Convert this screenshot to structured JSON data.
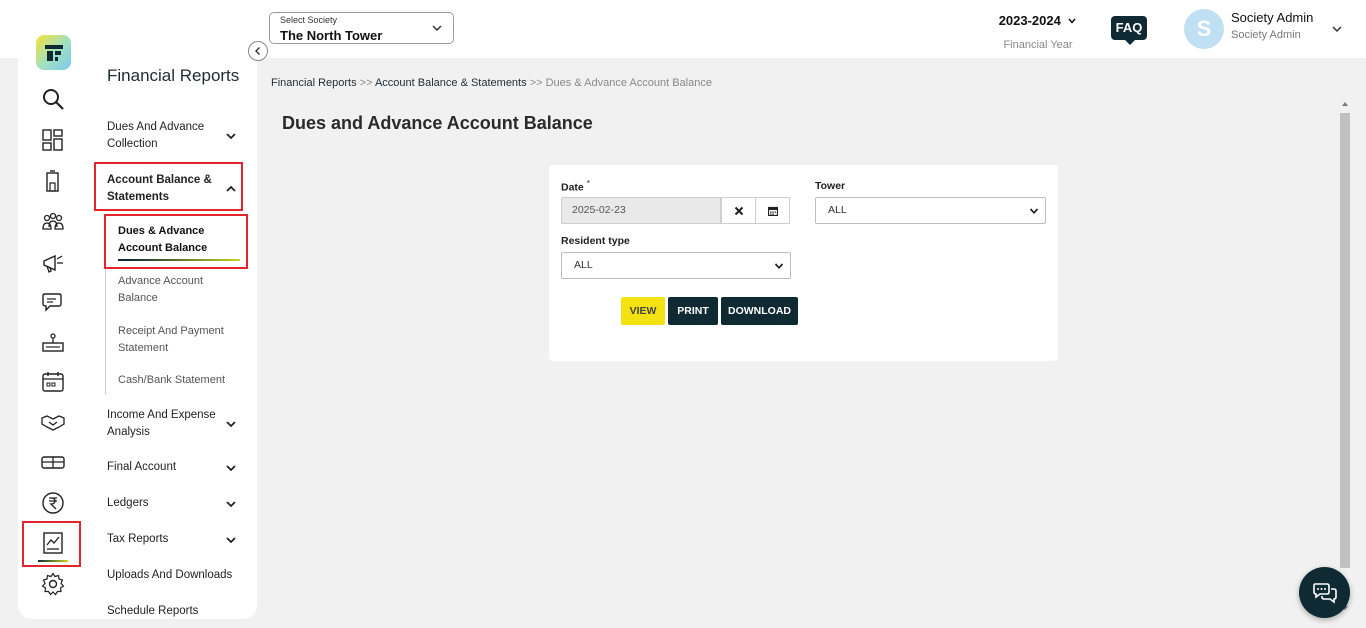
{
  "header": {
    "society_label": "Select Society",
    "society_value": "The North Tower",
    "financial_year": "2023-2024",
    "financial_year_label": "Financial Year",
    "faq_label": "FAQ",
    "avatar_initial": "S",
    "user_name": "Society Admin",
    "user_role": "Society Admin"
  },
  "sidebar": {
    "title": "Financial Reports",
    "items": [
      {
        "label": "Dues And Advance Collection"
      },
      {
        "label": "Account Balance & Statements"
      },
      {
        "label": "Income And Expense Analysis"
      },
      {
        "label": "Final Account"
      },
      {
        "label": "Ledgers"
      },
      {
        "label": "Tax Reports"
      },
      {
        "label": "Uploads And Downloads"
      },
      {
        "label": "Schedule Reports"
      }
    ],
    "sub_items": [
      {
        "label": "Dues & Advance Account Balance"
      },
      {
        "label": "Advance Account Balance"
      },
      {
        "label": "Receipt And Payment Statement"
      },
      {
        "label": "Cash/Bank Statement"
      }
    ],
    "rail_icons": [
      "search-icon",
      "dashboard-icon",
      "building-icon",
      "residents-icon",
      "announcement-icon",
      "chat-icon",
      "facility-icon",
      "calendar-icon",
      "handshake-icon",
      "parking-icon",
      "rupee-icon",
      "reports-icon",
      "settings-icon"
    ]
  },
  "breadcrumb": {
    "part1": "Financial Reports",
    "sep": ">>",
    "part2": "Account Balance & Statements",
    "part3": "Dues & Advance Account Balance"
  },
  "page": {
    "title": "Dues and Advance Account Balance"
  },
  "form": {
    "date_label": "Date",
    "date_required": "*",
    "date_value": "2025-02-23",
    "tower_label": "Tower",
    "tower_value": "ALL",
    "resident_type_label": "Resident type",
    "resident_type_value": "ALL",
    "view_label": "VIEW",
    "print_label": "PRINT",
    "download_label": "DOWNLOAD"
  },
  "colors": {
    "primary": "#0f2a33",
    "accent": "#f3e110",
    "highlight": "#e3262d"
  }
}
